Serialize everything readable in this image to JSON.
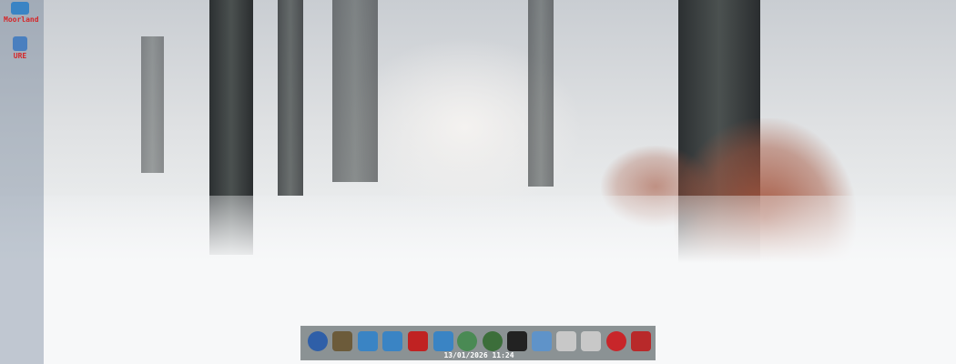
{
  "desktop": {
    "icons": [
      {
        "label": "Moorland",
        "icon": "drawer-icon"
      },
      {
        "label": "URE",
        "icon": "floppy-disk-icon"
      }
    ]
  },
  "dock": {
    "items": [
      {
        "icon": "info-key-icon",
        "color": "#2f5fa8"
      },
      {
        "icon": "screen-mode-icon",
        "color": "#6c5b3a"
      },
      {
        "icon": "drawer-edit-icon",
        "color": "#3a84c4"
      },
      {
        "icon": "drawer-icon",
        "color": "#3a84c4"
      },
      {
        "icon": "drawer-red-button-icon",
        "color": "#c02222"
      },
      {
        "icon": "window-prefs-icon",
        "color": "#3a84c4"
      },
      {
        "icon": "info-gauge-icon",
        "color": "#4a8a54"
      },
      {
        "icon": "globe-network-icon",
        "color": "#3c6e3a"
      },
      {
        "icon": "pdf-viewer-icon",
        "color": "#222222"
      },
      {
        "icon": "window-icon",
        "color": "#5f93c9"
      },
      {
        "icon": "spreadsheet-icon",
        "color": "#c8c8c8"
      },
      {
        "icon": "spreadsheet-2-icon",
        "color": "#c8c8c8"
      },
      {
        "icon": "boing-ball-icon",
        "color": "#c8262a"
      },
      {
        "icon": "trash-can-icon",
        "color": "#b8292a"
      }
    ],
    "clock": "13/01/2026 11:24"
  }
}
